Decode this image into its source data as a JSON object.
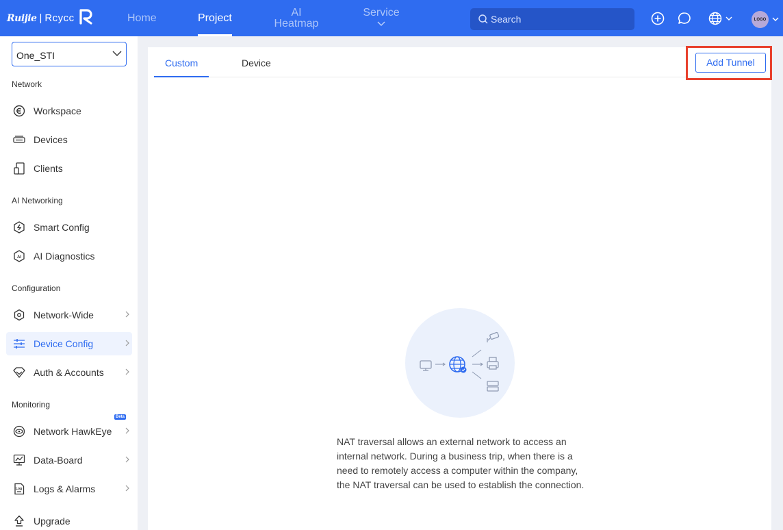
{
  "brand": {
    "ruijie": "Ruijie",
    "separator": "|",
    "reyee": "Rcycc"
  },
  "nav": {
    "home": "Home",
    "project": "Project",
    "ai_heatmap_line1": "AI",
    "ai_heatmap_line2": "Heatmap",
    "service": "Service"
  },
  "search": {
    "placeholder": "Search"
  },
  "header_icons": [
    "add-circle-icon",
    "chat-icon",
    "globe-icon",
    "avatar"
  ],
  "avatar_text": "LOGO",
  "sidebar": {
    "project_select": "One_STI",
    "sections": {
      "network": "Network",
      "ai_networking": "AI Networking",
      "configuration": "Configuration",
      "monitoring": "Monitoring"
    },
    "items": {
      "workspace": "Workspace",
      "devices": "Devices",
      "clients": "Clients",
      "smart_config": "Smart Config",
      "ai_diagnostics": "AI Diagnostics",
      "network_wide": "Network-Wide",
      "device_config": "Device Config",
      "auth_accounts": "Auth & Accounts",
      "network_hawkeye": "Network HawkEye",
      "hawkeye_badge": "Beta",
      "data_board": "Data-Board",
      "logs_alarms": "Logs & Alarms",
      "upgrade": "Upgrade"
    }
  },
  "main": {
    "tabs": {
      "custom": "Custom",
      "device": "Device"
    },
    "add_tunnel": "Add Tunnel",
    "empty_text": "NAT traversal allows an external network to access an internal network. During a business trip, when there is a need to remotely access a computer within the company, the NAT traversal can be used to establish the connection."
  },
  "colors": {
    "brand_blue": "#2f6cf0",
    "highlight_red": "#e8412d"
  }
}
